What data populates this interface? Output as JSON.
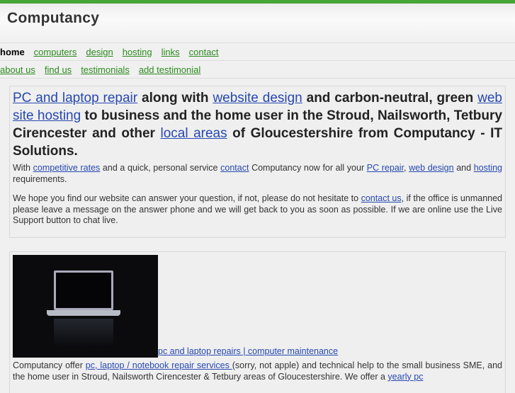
{
  "header": {
    "title": "Computancy"
  },
  "nav": {
    "row1": [
      "home",
      "computers",
      "design",
      "hosting",
      "links",
      "contact"
    ],
    "row2": [
      "about us",
      "find us",
      "testimonials",
      "add testimonial"
    ]
  },
  "intro": {
    "h_link1": "PC and laptop repair",
    "h_t1": " along with ",
    "h_link2": "website design",
    "h_t2": " and carbon-neutral, green ",
    "h_link3": "web site hosting",
    "h_t3": " to business and the home user in the Stroud, Nailsworth, Tetbury Cirencester and other ",
    "h_link4": "local areas",
    "h_t4": " of Gloucestershire from Computancy - IT Solutions.",
    "p1_t1": "With ",
    "p1_l1": "competitive rates",
    "p1_t2": " and a quick, personal service ",
    "p1_l2": "contact",
    "p1_t3": " Computancy now for all your ",
    "p1_l3": "PC repair",
    "p1_t4": ", ",
    "p1_l4": "web design",
    "p1_t5": " and ",
    "p1_l5": "hosting",
    "p1_t6": " requirements.",
    "p2_t1": "We hope you find our website can answer your question, if not, please do not hesitate to ",
    "p2_l1": "contact us",
    "p2_t2": ", if the office is unmanned please leave a message on the answer phone and we will get back to you as soon as possible. If we are online use the Live Support button to chat live."
  },
  "repair": {
    "caption": "pc and laptop repairs | computer maintenance",
    "t1": "Computancy offer ",
    "l1": "pc, laptop / notebook repair services ",
    "t2": "(sorry, not apple) and technical help to the small business SME, and the home user in Stroud, Nailsworth Cirencester & Tetbury areas of Gloucestershire. We offer a ",
    "l2": "yearly pc"
  }
}
